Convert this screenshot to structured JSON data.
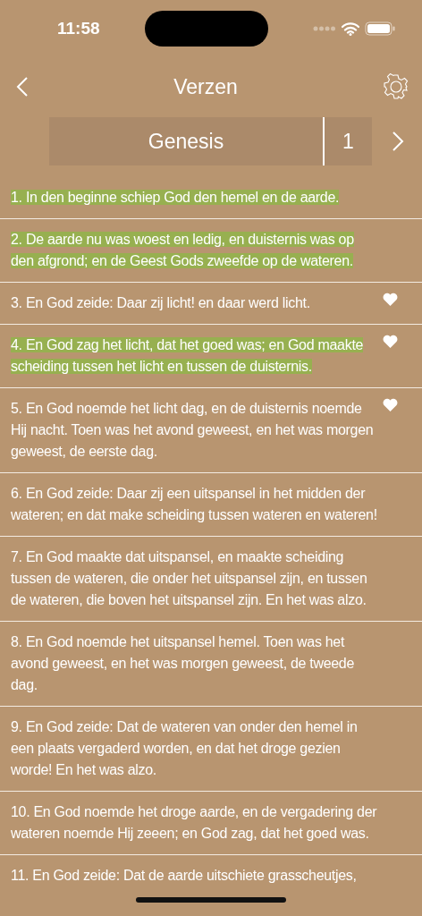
{
  "status_bar": {
    "time": "11:58"
  },
  "nav": {
    "title": "Verzen"
  },
  "selector": {
    "book": "Genesis",
    "chapter": "1"
  },
  "verses": [
    {
      "text": "1. In den beginne schiep God den hemel en de aarde.",
      "highlighted": true,
      "favorite": false
    },
    {
      "text": "2. De aarde nu was woest en ledig, en duisternis was op den afgrond; en de Geest Gods zweefde op de wateren.",
      "highlighted": true,
      "favorite": false
    },
    {
      "text": "3. En God zeide: Daar zij licht! en daar werd licht.",
      "highlighted": false,
      "favorite": true
    },
    {
      "text": "4. En God zag het licht, dat het goed was; en God maakte scheiding tussen het licht en tussen de duisternis.",
      "highlighted": true,
      "favorite": true
    },
    {
      "text": "5. En God noemde het licht dag, en de duisternis noemde Hij nacht. Toen was het avond geweest, en het was morgen geweest, de eerste dag.",
      "highlighted": false,
      "favorite": true
    },
    {
      "text": "6. En God zeide: Daar zij een uitspansel in het midden der wateren; en dat make scheiding tussen wateren en wateren!",
      "highlighted": false,
      "favorite": false
    },
    {
      "text": "7. En God maakte dat uitspansel, en maakte scheiding tussen de wateren, die onder het uitspansel zijn, en tussen de wateren, die boven het uitspansel zijn. En het was alzo.",
      "highlighted": false,
      "favorite": false
    },
    {
      "text": "8. En God noemde het uitspansel hemel. Toen was het avond geweest, en het was morgen geweest, de tweede dag.",
      "highlighted": false,
      "favorite": false
    },
    {
      "text": "9. En God zeide: Dat de wateren van onder den hemel in een plaats vergaderd worden, en dat het droge gezien worde! En het was alzo.",
      "highlighted": false,
      "favorite": false
    },
    {
      "text": "10. En God noemde het droge aarde, en de vergadering der wateren noemde Hij zeeen; en God zag, dat het goed was.",
      "highlighted": false,
      "favorite": false
    },
    {
      "text": "11. En God zeide: Dat de aarde uitschiete grasscheutjes,",
      "highlighted": false,
      "favorite": false
    }
  ]
}
